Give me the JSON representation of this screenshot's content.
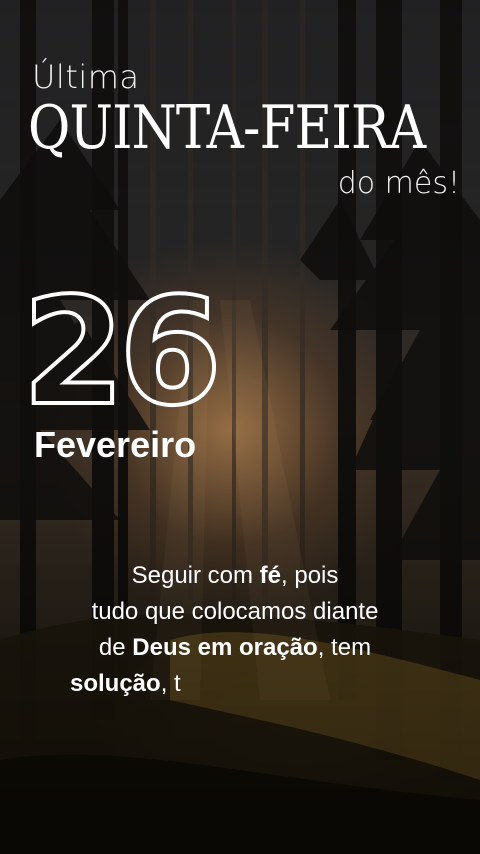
{
  "header": {
    "pre_title": "Última",
    "title": "QUINTA-FEIRA",
    "post_title": "do mês!"
  },
  "date": {
    "day": "26",
    "month": "Fevereiro"
  },
  "quote": {
    "l1_a": "Seguir com ",
    "l1_b": "fé",
    "l1_c": ", pois",
    "l2": "tudo que colocamos diante",
    "l3_a": "de ",
    "l3_b": "Deus em oração",
    "l3_c": ", tem",
    "l4_a": "solução",
    "l4_b": ", t"
  },
  "colors": {
    "text": "#ffffff",
    "background_dark": "#141210",
    "sun_glow": "#e6a55f"
  }
}
